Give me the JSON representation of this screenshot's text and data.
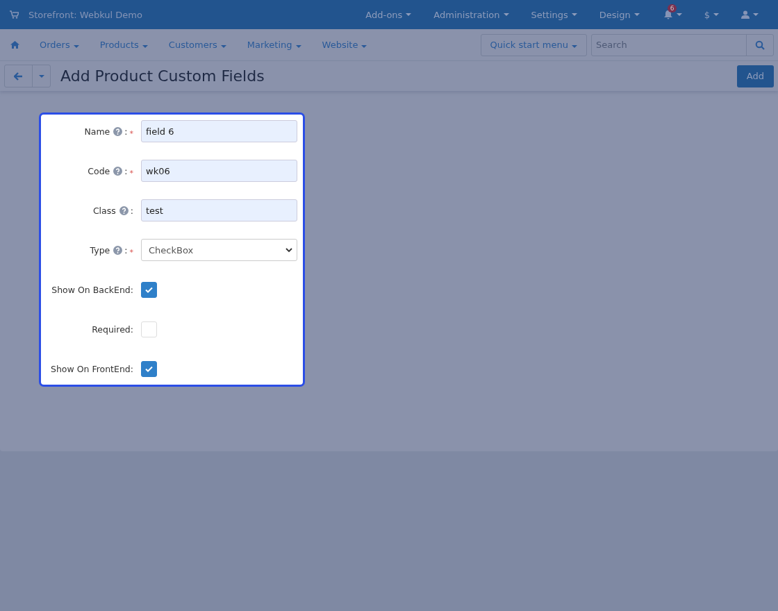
{
  "top_bar": {
    "store": "Storefront: Webkul Demo",
    "menus": [
      "Add-ons",
      "Administration",
      "Settings",
      "Design"
    ],
    "notification_count": "6",
    "currency": "$"
  },
  "nav": {
    "items": [
      "Orders",
      "Products",
      "Customers",
      "Marketing",
      "Website"
    ],
    "quick_start": "Quick start menu",
    "search": {
      "placeholder": "Search"
    }
  },
  "page": {
    "title": "Add Product Custom Fields",
    "add_button": "Add"
  },
  "form": [
    {
      "kind": "text",
      "label": "Name",
      "help": true,
      "colon": ":",
      "required_mark": "*",
      "value": "field 6"
    },
    {
      "kind": "text",
      "label": "Code",
      "help": true,
      "colon": ":",
      "required_mark": "*",
      "value": "wk06"
    },
    {
      "kind": "text",
      "label": "Class",
      "help": true,
      "colon": ":",
      "value": "test"
    },
    {
      "kind": "select",
      "label": "Type",
      "help": true,
      "colon": ":",
      "required_mark": "*",
      "value": "CheckBox"
    },
    {
      "kind": "checkbox",
      "label": "Show On BackEnd:",
      "checked": true
    },
    {
      "kind": "checkbox",
      "label": "Required:",
      "checked": false
    },
    {
      "kind": "checkbox",
      "label": "Show On FrontEnd:",
      "checked": true
    }
  ]
}
